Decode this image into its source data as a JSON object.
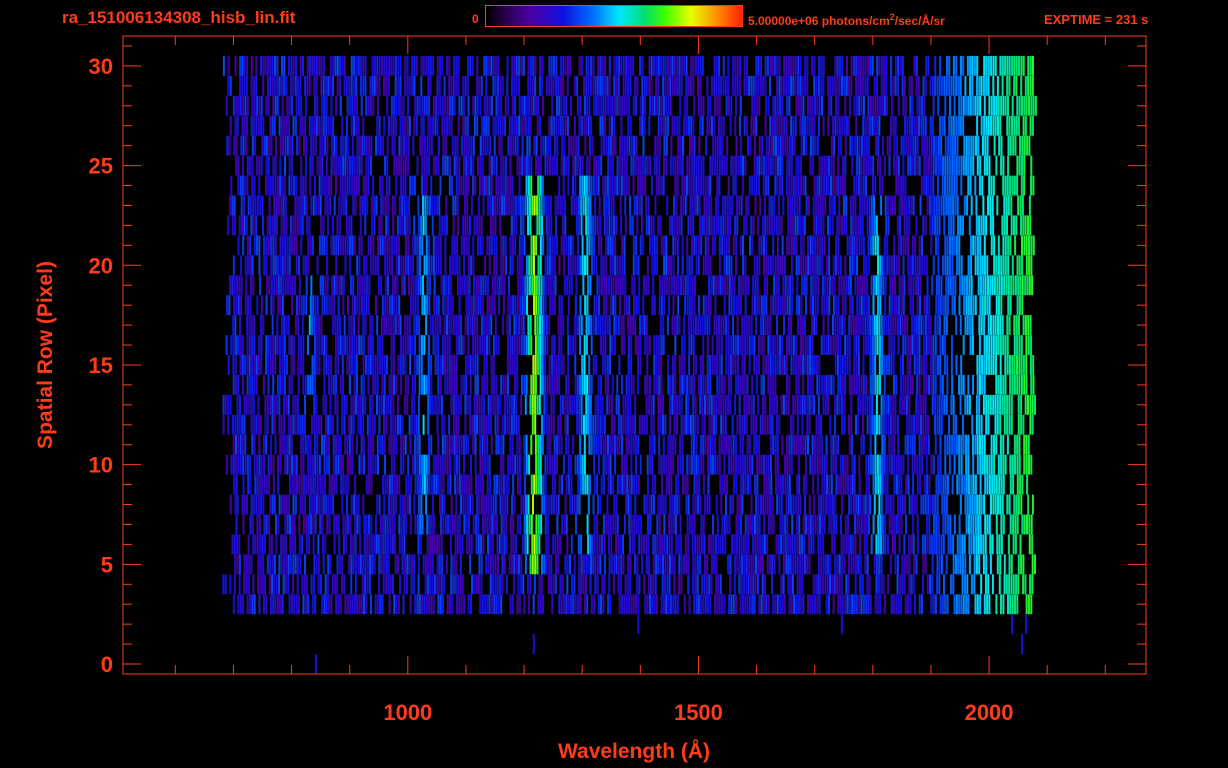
{
  "header": {
    "title": "ra_151006134308_hisb_lin.fit",
    "colorbar_min": "0",
    "colorbar_max_prefix": "5.00000e+06 photons/cm",
    "colorbar_max_exp": "2",
    "colorbar_max_suffix": "/sec/Å/sr",
    "exptime": "EXPTIME = 231 s"
  },
  "chart_data": {
    "type": "heatmap",
    "title": "ra_151006134308_hisb_lin.fit",
    "xlabel": "Wavelength (Å)",
    "ylabel": "Spatial Row (Pixel)",
    "xlim": [
      510,
      2270
    ],
    "ylim": [
      -0.5,
      31.5
    ],
    "x_ticks": [
      1000,
      1500,
      2000
    ],
    "x_tick_labels": [
      "1000",
      "1500",
      "2000"
    ],
    "y_ticks": [
      0,
      5,
      10,
      15,
      20,
      25,
      30
    ],
    "y_tick_labels": [
      "0",
      "5",
      "10",
      "15",
      "20",
      "25",
      "30"
    ],
    "colorbar": {
      "min": 0,
      "max": 5000000,
      "units": "photons/cm^2/sec/Å/sr"
    },
    "exptime_s": 231,
    "signal_extent_x": [
      690,
      2070
    ],
    "signal_extent_y": [
      3,
      30
    ],
    "emission_features": [
      {
        "wavelength": 1216,
        "rows": [
          5,
          24
        ],
        "peak_level": 0.75
      },
      {
        "wavelength": 1304,
        "rows": [
          6,
          24
        ],
        "peak_level": 0.5
      },
      {
        "wavelength": 1026,
        "rows": [
          7,
          23
        ],
        "peak_level": 0.45
      },
      {
        "wavelength": 830,
        "rows": [
          13,
          19
        ],
        "peak_level": 0.4
      },
      {
        "wavelength": 1806,
        "rows": [
          6,
          23
        ],
        "peak_level": 0.5
      }
    ],
    "continuum_rise": {
      "start_wavelength": 1900,
      "end_wavelength": 2060,
      "peak_level": 0.62
    }
  }
}
